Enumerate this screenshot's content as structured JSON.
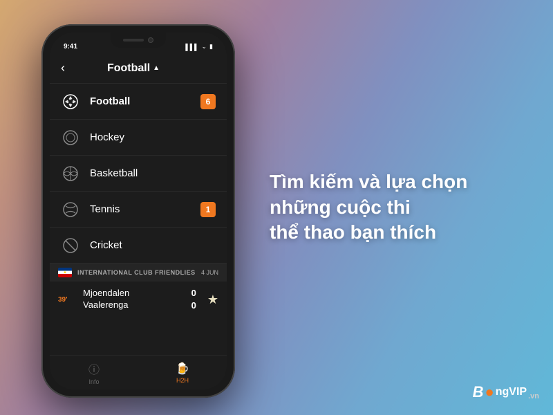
{
  "background": {
    "gradient_start": "#d4a870",
    "gradient_end": "#60b8d8"
  },
  "phone": {
    "status_bar": {
      "time": "9:41",
      "icons": [
        "signal",
        "wifi",
        "battery"
      ]
    },
    "header": {
      "back_label": "‹",
      "title": "Football",
      "arrow": "▲"
    },
    "sports": [
      {
        "id": "football",
        "name": "Football",
        "icon": "⚽",
        "badge": "6",
        "active": true
      },
      {
        "id": "hockey",
        "name": "Hockey",
        "icon": "🏒",
        "badge": null,
        "active": false
      },
      {
        "id": "basketball",
        "name": "Basketball",
        "icon": "🏀",
        "badge": null,
        "active": false
      },
      {
        "id": "tennis",
        "name": "Tennis",
        "icon": "🎾",
        "badge": "1",
        "active": false
      },
      {
        "id": "cricket",
        "name": "Cricket",
        "icon": "🏏",
        "badge": null,
        "active": false
      }
    ],
    "match": {
      "league": "INTERNATIONAL CLUB FRIENDLIES",
      "date": "4 JUN",
      "time": "39'",
      "team1": "Mjoendalen",
      "team2": "Vaalerenga",
      "score1": "0",
      "score2": "0",
      "star": "★"
    },
    "tabs": [
      {
        "id": "info",
        "label": "Info",
        "icon": "ℹ",
        "active": false
      },
      {
        "id": "h2h",
        "label": "H2H",
        "icon": "🍺",
        "active": true
      }
    ]
  },
  "promo": {
    "line1": "Tìm kiếm và lựa chọn",
    "line2": "những cuộc thi",
    "line3": "thể thao bạn thích"
  },
  "logo": {
    "text": "BongVIP",
    "suffix": ".vn"
  }
}
